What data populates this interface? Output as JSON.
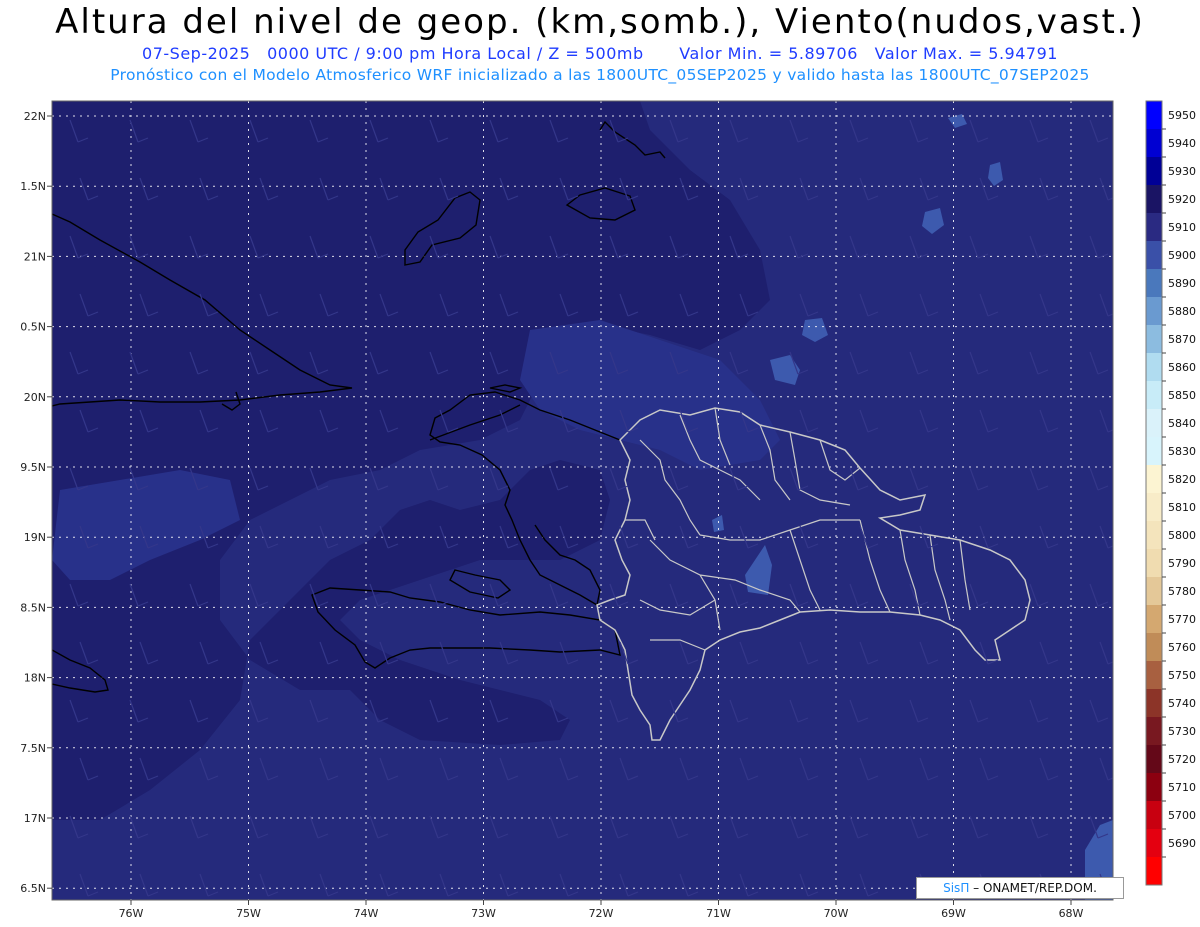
{
  "header": {
    "title": "Altura del nivel de geop. (km,somb.), Viento(nudos,vast.)",
    "date": "07-Sep-2025",
    "time_info": "0000 UTC / 9:00 pm Hora Local / Z = 500mb",
    "min_value": "Valor Min. = 5.89706",
    "max_value": "Valor Max. = 5.94791",
    "model_info": "Pronóstico con el Modelo Atmosferico WRF inicializado a las 1800UTC_05SEP2025 y valido hasta las  1800UTC_07SEP2025"
  },
  "map": {
    "lat_labels": [
      "22N",
      "1.5N",
      "21N",
      "0.5N",
      "20N",
      "9.5N",
      "19N",
      "8.5N",
      "18N",
      "7.5N",
      "17N",
      "6.5N"
    ],
    "lon_labels": [
      "76W",
      "75W",
      "74W",
      "73W",
      "72W",
      "71W",
      "70W",
      "69W",
      "68W"
    ],
    "background_color": "#252a7c",
    "darker_color": "#1e1f6e",
    "lighter_color": "#2f3b90",
    "coast_color": "#000000",
    "border_color": "#c8c8c8"
  },
  "legend": {
    "levels": [
      "5950",
      "5940",
      "5930",
      "5920",
      "5910",
      "5900",
      "5890",
      "5880",
      "5870",
      "5860",
      "5850",
      "5840",
      "5830",
      "5820",
      "5810",
      "5800",
      "5790",
      "5780",
      "5770",
      "5760",
      "5750",
      "5740",
      "5730",
      "5720",
      "5710",
      "5700",
      "5690"
    ],
    "colors": [
      "#0000ff",
      "#0000d2",
      "#000096",
      "#1a1464",
      "#2a2a82",
      "#3a50a8",
      "#4a78bc",
      "#6a9ad0",
      "#8cbce0",
      "#b0dcf0",
      "#c8ecf8",
      "#daf2fa",
      "#d8f4fc",
      "#fcf4d2",
      "#f8ecc8",
      "#f4e4bc",
      "#f0dcb0",
      "#e4c898",
      "#d4a870",
      "#c08c58",
      "#a86040",
      "#8c3428",
      "#781820",
      "#640818",
      "#8c0010",
      "#c80010",
      "#e40010",
      "#ff0000"
    ]
  },
  "credit": {
    "logo": "SisΠ",
    "text": "– ONAMET/REP.DOM."
  }
}
